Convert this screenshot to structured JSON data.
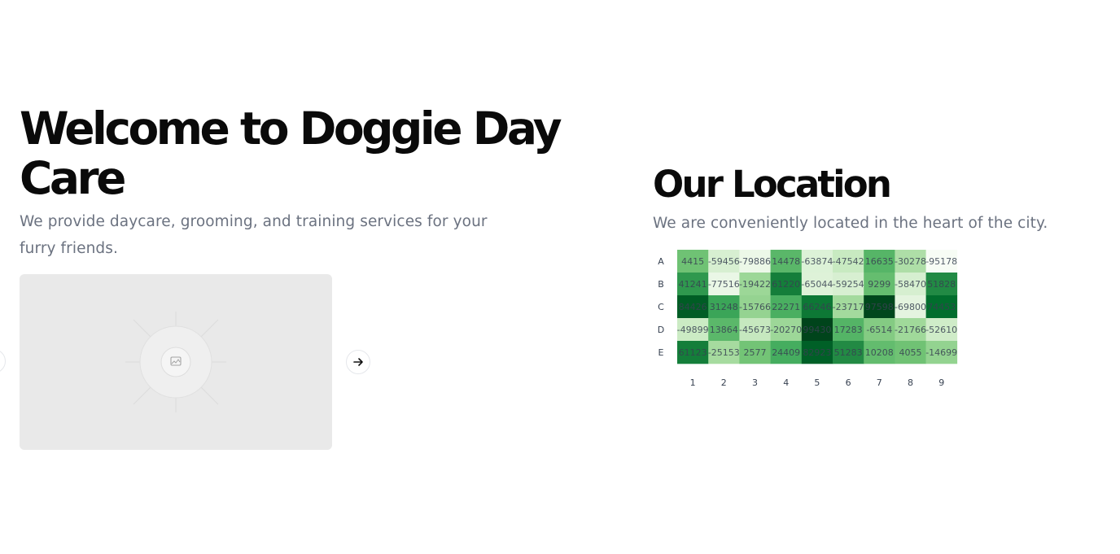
{
  "hero": {
    "title": "Welcome to Doggie Day Care",
    "subtitle": "We provide daycare, grooming, and training services for your furry friends."
  },
  "carousel": {
    "slide_icon": "image-placeholder-icon",
    "prev_icon": "arrow-left-icon",
    "next_icon": "arrow-right-icon"
  },
  "location": {
    "title": "Our Location",
    "subtitle": "We are conveniently located in the heart of the city."
  },
  "colors": {
    "text_primary": "#0a0a0a",
    "text_muted": "#6b7280",
    "placeholder_bg": "#e9e9e9",
    "heat_low": "#f7fcf5",
    "heat_high": "#00441b"
  },
  "chart_data": {
    "type": "heatmap",
    "rows": [
      "A",
      "B",
      "C",
      "D",
      "E"
    ],
    "columns": [
      "1",
      "2",
      "3",
      "4",
      "5",
      "6",
      "7",
      "8",
      "9"
    ],
    "values": [
      [
        4415,
        -59456,
        -79886,
        14478,
        -63874,
        -47542,
        16635,
        -30278,
        -95178
      ],
      [
        41241,
        -77516,
        -19422,
        61220,
        -65044,
        -59254,
        9299,
        -58470,
        51828
      ],
      [
        84426,
        31248,
        -15766,
        22271,
        66246,
        -23717,
        97598,
        -69800,
        74453
      ],
      [
        -49899,
        13864,
        -45673,
        -20270,
        99430,
        17283,
        -6514,
        -21766,
        -52610
      ],
      [
        61123,
        -25153,
        2577,
        24409,
        82923,
        51283,
        10208,
        4055,
        -14699
      ]
    ],
    "colorscale": "greens",
    "grid": false
  }
}
